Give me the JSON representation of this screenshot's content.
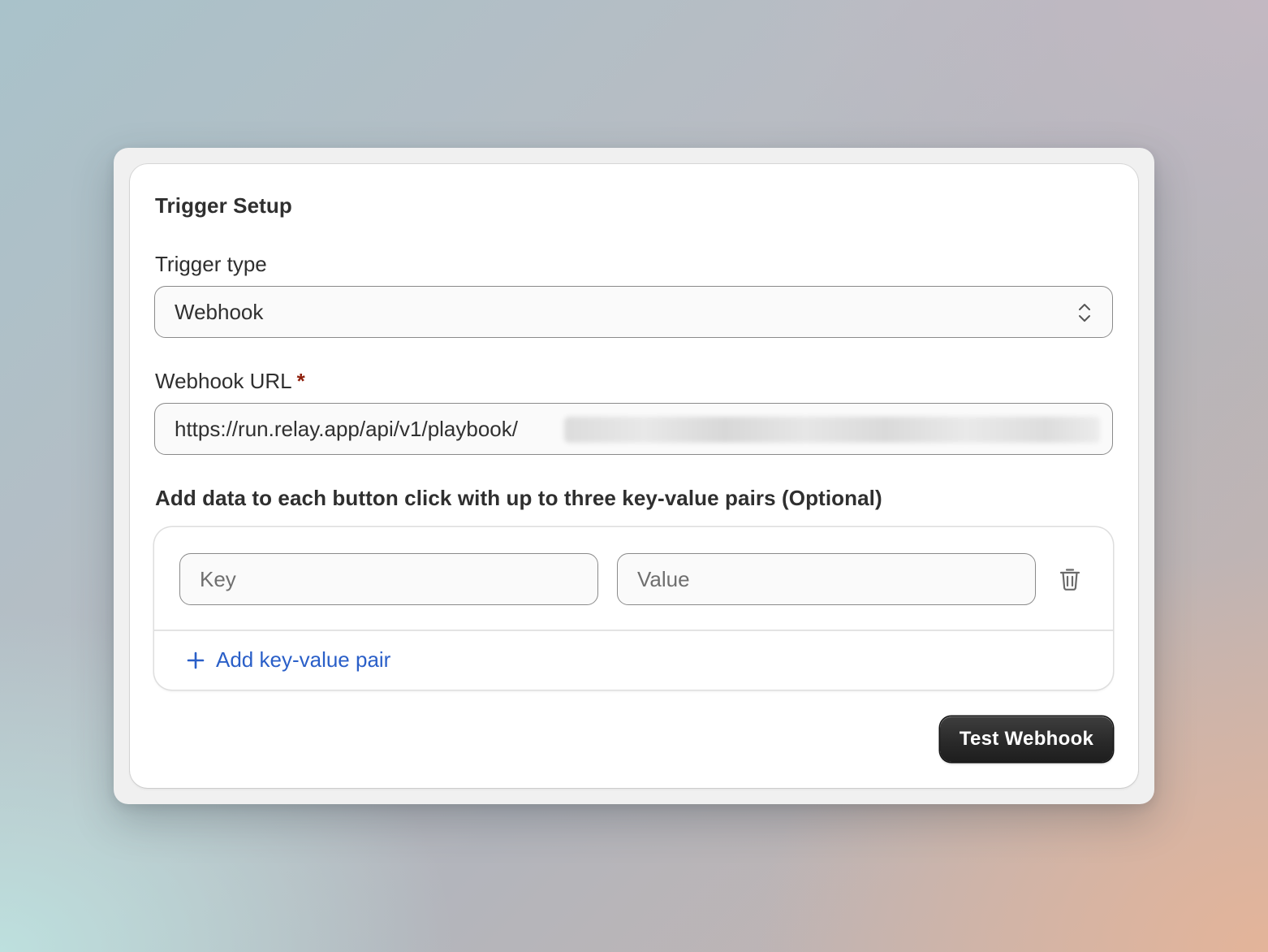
{
  "trigger_setup": {
    "title": "Trigger Setup",
    "trigger_type": {
      "label": "Trigger type",
      "selected": "Webhook",
      "icon": "chevron-up-down-icon"
    },
    "webhook_url": {
      "label": "Webhook URL",
      "required_marker": "*",
      "value_visible": "https://run.relay.app/api/v1/playbook/",
      "value_obscured": true
    },
    "key_value": {
      "heading": "Add data to each button click with up to three key-value pairs (Optional)",
      "rows": [
        {
          "key_placeholder": "Key",
          "value_placeholder": "Value",
          "delete_icon": "trash-icon"
        }
      ],
      "add_label": "Add key-value pair",
      "add_icon": "plus-icon"
    },
    "test_button_label": "Test Webhook"
  },
  "colors": {
    "accent_link": "#2a5fc8",
    "required_star": "#8e1f0b",
    "button_bg": "#2a2a2a",
    "input_border": "#8a8a8a"
  }
}
